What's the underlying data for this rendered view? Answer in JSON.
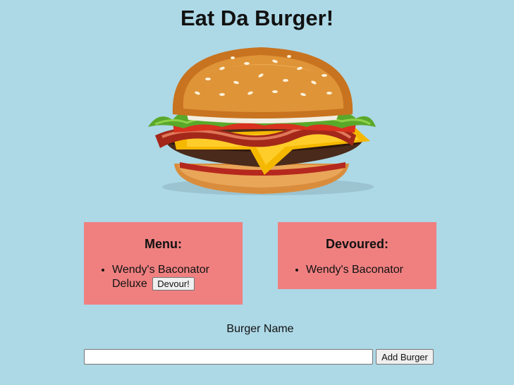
{
  "page": {
    "title": "Eat Da Burger!",
    "background_color": "#add8e6",
    "panel_color": "#f08080"
  },
  "hero_image": {
    "icon": "burger-image"
  },
  "menu": {
    "heading": "Menu:",
    "items": [
      {
        "label": "Wendy's Baconator Deluxe",
        "button_label": "Devour!"
      }
    ]
  },
  "devoured": {
    "heading": "Devoured:",
    "items": [
      {
        "label": "Wendy's Baconator"
      }
    ]
  },
  "form": {
    "label": "Burger Name",
    "input_value": "",
    "submit_label": "Add Burger"
  }
}
